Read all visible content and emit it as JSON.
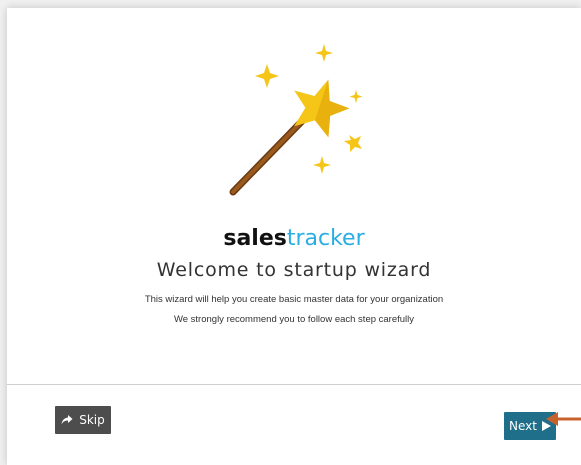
{
  "brand": {
    "part_1": "sales",
    "part_2": "tracker"
  },
  "wizard": {
    "title": "Welcome to startup wizard",
    "description_1": "This wizard will help you create basic master data for your organization",
    "description_2": "We strongly recommend you to follow each step carefully",
    "illustration_icon": "magic-wand-icon"
  },
  "actions": {
    "skip_label": "Skip",
    "skip_icon": "share-arrow-icon",
    "next_label": "Next",
    "next_icon": "play-triangle-icon"
  },
  "annotation": {
    "pointer_icon": "left-arrow-icon",
    "pointer_color": "#c8622d"
  },
  "colors": {
    "brand_dark": "#111111",
    "brand_accent": "#29aee3",
    "star": "#f5c518",
    "wand_handle": "#8b4a14",
    "skip_button_bg": "#4d4d4d",
    "next_button_bg": "#1f6f8b"
  }
}
